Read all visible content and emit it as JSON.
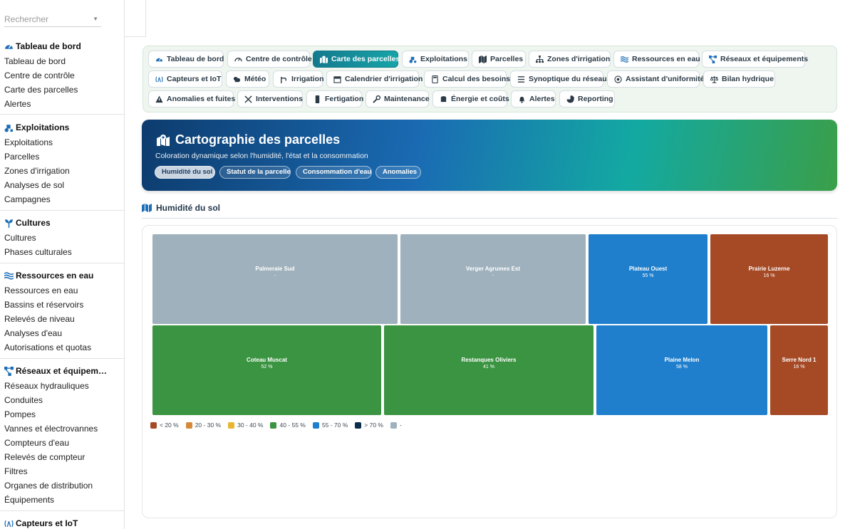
{
  "search": {
    "placeholder": "Rechercher"
  },
  "sidebar": {
    "sections": [
      {
        "title": "Tableau de bord",
        "icon": "gauge-icon",
        "items": [
          "Tableau de bord",
          "Centre de contrôle",
          "Carte des parcelles",
          "Alertes"
        ]
      },
      {
        "title": "Exploitations",
        "icon": "tractor-icon",
        "items": [
          "Exploitations",
          "Parcelles",
          "Zones d'irrigation",
          "Analyses de sol",
          "Campagnes"
        ]
      },
      {
        "title": "Cultures",
        "icon": "seedling-icon",
        "items": [
          "Cultures",
          "Phases culturales"
        ]
      },
      {
        "title": "Ressources en eau",
        "icon": "water-icon",
        "items": [
          "Ressources en eau",
          "Bassins et réservoirs",
          "Relevés de niveau",
          "Analyses d'eau",
          "Autorisations et quotas"
        ]
      },
      {
        "title": "Réseaux et équipem…",
        "icon": "network-icon",
        "items": [
          "Réseaux hydrauliques",
          "Conduites",
          "Pompes",
          "Vannes et électrovannes",
          "Compteurs d'eau",
          "Relevés de compteur",
          "Filtres",
          "Organes de distribution",
          "Équipements"
        ]
      },
      {
        "title": "Capteurs et IoT",
        "icon": "sensor-icon",
        "items": []
      }
    ]
  },
  "tabs": [
    {
      "label": "Tableau de bord",
      "icon": "gauge-icon",
      "active": false
    },
    {
      "label": "Centre de contrôle",
      "icon": "dashboard-icon",
      "active": false
    },
    {
      "label": "Carte des parcelles",
      "icon": "map-pin-icon",
      "active": true
    },
    {
      "label": "Exploitations",
      "icon": "tractor-icon",
      "active": false
    },
    {
      "label": "Parcelles",
      "icon": "map-icon",
      "active": false
    },
    {
      "label": "Zones d'irrigation",
      "icon": "sitemap-icon",
      "active": false
    },
    {
      "label": "Ressources en eau",
      "icon": "water-icon",
      "active": false
    },
    {
      "label": "Réseaux et équipements",
      "icon": "network-icon",
      "active": false
    },
    {
      "label": "Capteurs et IoT",
      "icon": "sensor-icon",
      "active": false
    },
    {
      "label": "Météo",
      "icon": "cloud-icon",
      "active": false
    },
    {
      "label": "Irrigation",
      "icon": "faucet-icon",
      "active": false
    },
    {
      "label": "Calendrier d'irrigation",
      "icon": "calendar-icon",
      "active": false
    },
    {
      "label": "Calcul des besoins",
      "icon": "calculator-icon",
      "active": false
    },
    {
      "label": "Synoptique du réseau",
      "icon": "list-icon",
      "active": false
    },
    {
      "label": "Assistant d'uniformité",
      "icon": "target-icon",
      "active": false
    },
    {
      "label": "Bilan hydrique",
      "icon": "scale-icon",
      "active": false
    },
    {
      "label": "Anomalies et fuites",
      "icon": "warning-icon",
      "active": false
    },
    {
      "label": "Interventions",
      "icon": "tools-icon",
      "active": false
    },
    {
      "label": "Fertigation",
      "icon": "flask-icon",
      "active": false
    },
    {
      "label": "Maintenance",
      "icon": "wrench-icon",
      "active": false
    },
    {
      "label": "Énergie et coûts",
      "icon": "coins-icon",
      "active": false
    },
    {
      "label": "Alertes",
      "icon": "bell-icon",
      "active": false
    },
    {
      "label": "Reporting",
      "icon": "pie-icon",
      "active": false
    }
  ],
  "hero": {
    "title": "Cartographie des parcelles",
    "subtitle": "Coloration dynamique selon l'humidité, l'état et la consommation",
    "modes": [
      {
        "label": "Humidité du sol",
        "active": true
      },
      {
        "label": "Statut de la parcelle",
        "active": false
      },
      {
        "label": "Consommation d'eau",
        "active": false
      },
      {
        "label": "Anomalies",
        "active": false
      }
    ]
  },
  "section": {
    "title": "Humidité du sol"
  },
  "parcels": [
    {
      "name": "Palmeraie Sud",
      "value": "-",
      "color": "#9eb1bc"
    },
    {
      "name": "Verger Agrumes Est",
      "value": "-",
      "color": "#9eb1bc"
    },
    {
      "name": "Plateau Ouest",
      "value": "55 %",
      "color": "#1f7fcc"
    },
    {
      "name": "Prairie Luzerne",
      "value": "16 %",
      "color": "#a64a26"
    },
    {
      "name": "Coteau Muscat",
      "value": "52 %",
      "color": "#3b9441"
    },
    {
      "name": "Restanques Oliviers",
      "value": "41 %",
      "color": "#3b9441"
    },
    {
      "name": "Plaine Melon",
      "value": "58 %",
      "color": "#1f7fcc"
    },
    {
      "name": "Serre Nord 1",
      "value": "16 %",
      "color": "#a64a26"
    }
  ],
  "legend": [
    {
      "label": "< 20 %",
      "color": "#a64a26"
    },
    {
      "label": "20 - 30 %",
      "color": "#d48a3a"
    },
    {
      "label": "30 - 40 %",
      "color": "#e8b531"
    },
    {
      "label": "40 - 55 %",
      "color": "#3b9441"
    },
    {
      "label": "55 - 70 %",
      "color": "#1f7fcc"
    },
    {
      "label": "> 70 %",
      "color": "#0c2d4e"
    },
    {
      "label": "-",
      "color": "#9eb1bc"
    }
  ]
}
